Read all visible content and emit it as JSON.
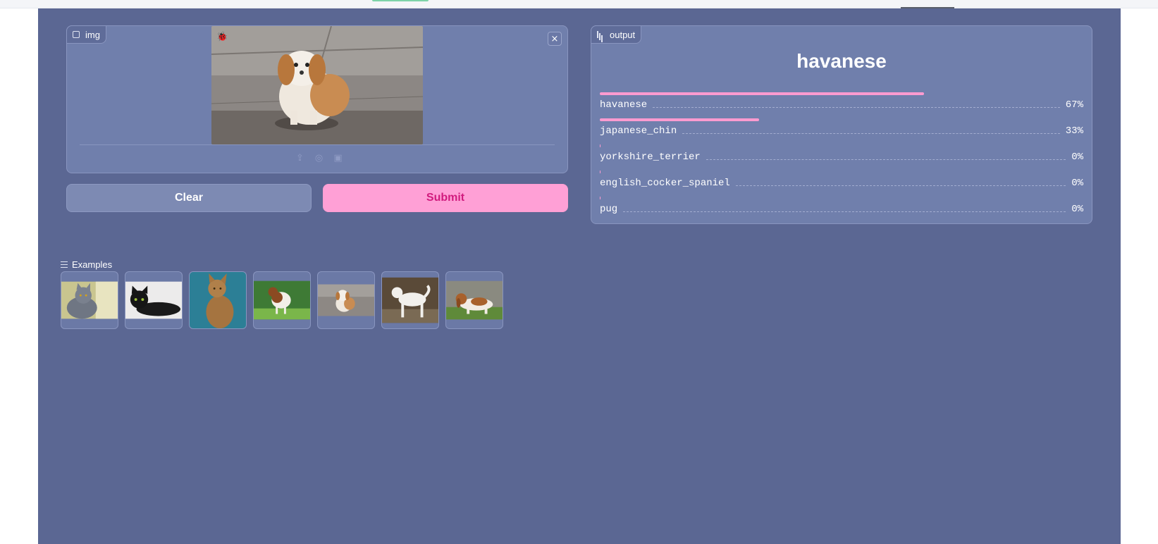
{
  "input": {
    "label": "img",
    "close_symbol": "×",
    "source_icons": [
      "upload-icon",
      "webcam-icon",
      "clipboard-icon"
    ]
  },
  "buttons": {
    "clear": "Clear",
    "submit": "Submit"
  },
  "output": {
    "label": "output",
    "top_prediction": "havanese",
    "confidences": [
      {
        "label": "havanese",
        "value": "67%",
        "fraction": 0.67
      },
      {
        "label": "japanese_chin",
        "value": "33%",
        "fraction": 0.33
      },
      {
        "label": "yorkshire_terrier",
        "value": "0%",
        "fraction": 0.0
      },
      {
        "label": "english_cocker_spaniel",
        "value": "0%",
        "fraction": 0.0
      },
      {
        "label": "pug",
        "value": "0%",
        "fraction": 0.0
      }
    ]
  },
  "examples": {
    "title": "Examples",
    "items": [
      "grey-cat",
      "black-cat",
      "abyssinian-cat",
      "saint-bernard",
      "shih-tzu",
      "white-dog",
      "basset-hound"
    ]
  },
  "colors": {
    "background": "#5b6793",
    "panel": "#707fac",
    "accent": "#ffa0d6",
    "accent_text": "#d11b7e"
  }
}
